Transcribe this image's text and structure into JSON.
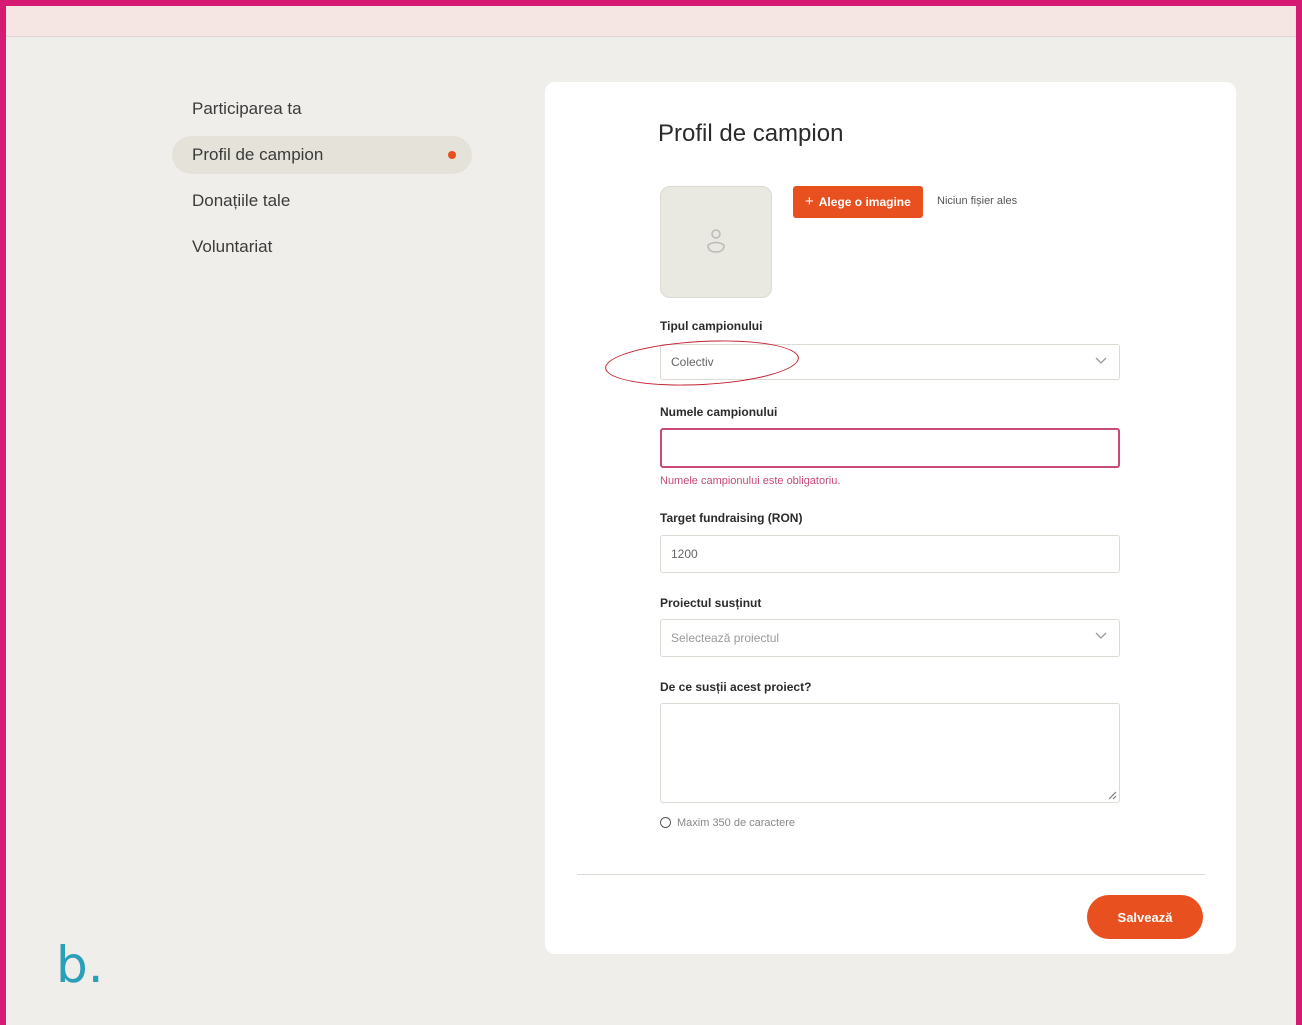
{
  "sidebar": {
    "items": [
      {
        "label": "Participarea ta"
      },
      {
        "label": "Profil de campion"
      },
      {
        "label": "Donațiile tale"
      },
      {
        "label": "Voluntariat"
      }
    ]
  },
  "form": {
    "title": "Profil de campion",
    "upload_button": "Alege o imagine",
    "no_file": "Niciun fișier ales",
    "type_label": "Tipul campionului",
    "type_value": "Colectiv",
    "name_label": "Numele campionului",
    "name_value": "",
    "name_error": "Numele campionului este obligatoriu.",
    "target_label": "Target fundraising (RON)",
    "target_value": "1200",
    "project_label": "Proiectul susținut",
    "project_placeholder": "Selectează proiectul",
    "reason_label": "De ce susții acest proiect?",
    "reason_value": "",
    "reason_hint": "Maxim 350 de caractere",
    "save_button": "Salvează"
  },
  "figure_label": "b.",
  "colors": {
    "accent": "#e8501f",
    "frame": "#d61a73",
    "error": "#c8497a",
    "annotation": "#c21f2e",
    "figure_label": "#2a9fb7"
  }
}
